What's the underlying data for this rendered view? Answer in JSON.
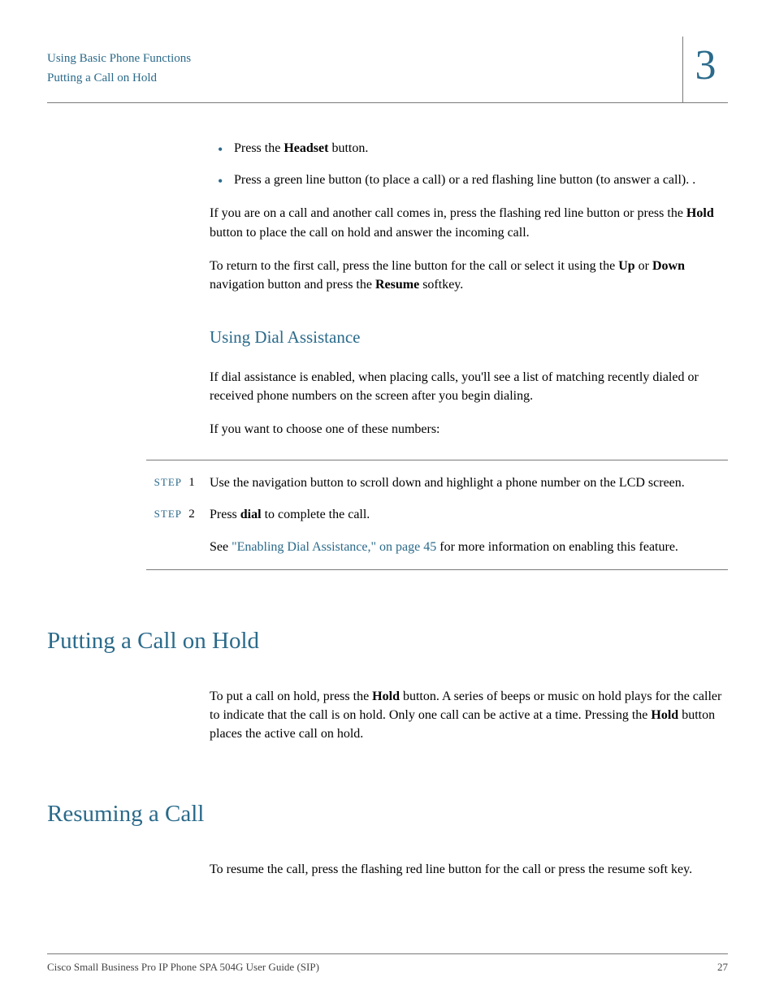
{
  "header": {
    "line1": "Using Basic Phone Functions",
    "line2": "Putting a Call on Hold",
    "chapter": "3"
  },
  "bullets": [
    {
      "pre": "Press the ",
      "bold": "Headset",
      "post": " button."
    },
    {
      "pre": "Press a green line button (to place a call) or a red flashing line button (to answer a call). .",
      "bold": "",
      "post": ""
    }
  ],
  "para1": {
    "pre": "If you are on a call and another call comes in, press the flashing red line button or press the ",
    "b1": "Hold",
    "post": " button to place the call on hold and answer the incoming call."
  },
  "para2": {
    "t0": "To return to the first call, press the line button for the call or select it using the ",
    "b1": "Up",
    "t1": " or ",
    "b2": "Down",
    "t2": " navigation button and press the ",
    "b3": "Resume",
    "t3": " softkey."
  },
  "dial": {
    "heading": "Using Dial Assistance",
    "para1": "If dial assistance is enabled, when placing calls, you'll see a list of matching recently dialed or received phone numbers on the screen after you begin dialing.",
    "para2": "If you want to choose one of these numbers:"
  },
  "steps": {
    "label": "STEP",
    "s1": {
      "num": "1",
      "text": "Use the navigation button to scroll down and highlight a phone number on the LCD screen."
    },
    "s2": {
      "num": "2",
      "pre": "Press ",
      "bold": "dial",
      "post": " to complete the call."
    },
    "followup": {
      "t0": "See ",
      "link": "\"Enabling Dial Assistance,\" on page 45",
      "t1": " for more information on enabling this feature."
    }
  },
  "hold": {
    "heading": "Putting a Call on Hold",
    "t0": "To put a call on hold, press the ",
    "b1": "Hold",
    "t1": " button. A series of beeps or music on hold plays for the caller to indicate that the call is on hold. Only one call can be active at a time. Pressing the ",
    "b2": "Hold",
    "t2": " button places the active call on hold."
  },
  "resume": {
    "heading": "Resuming a Call",
    "para": "To resume the call, press the flashing red line button for the call or press the resume soft key."
  },
  "footer": {
    "title": "Cisco Small Business Pro IP Phone SPA 504G User Guide (SIP)",
    "page": "27"
  }
}
